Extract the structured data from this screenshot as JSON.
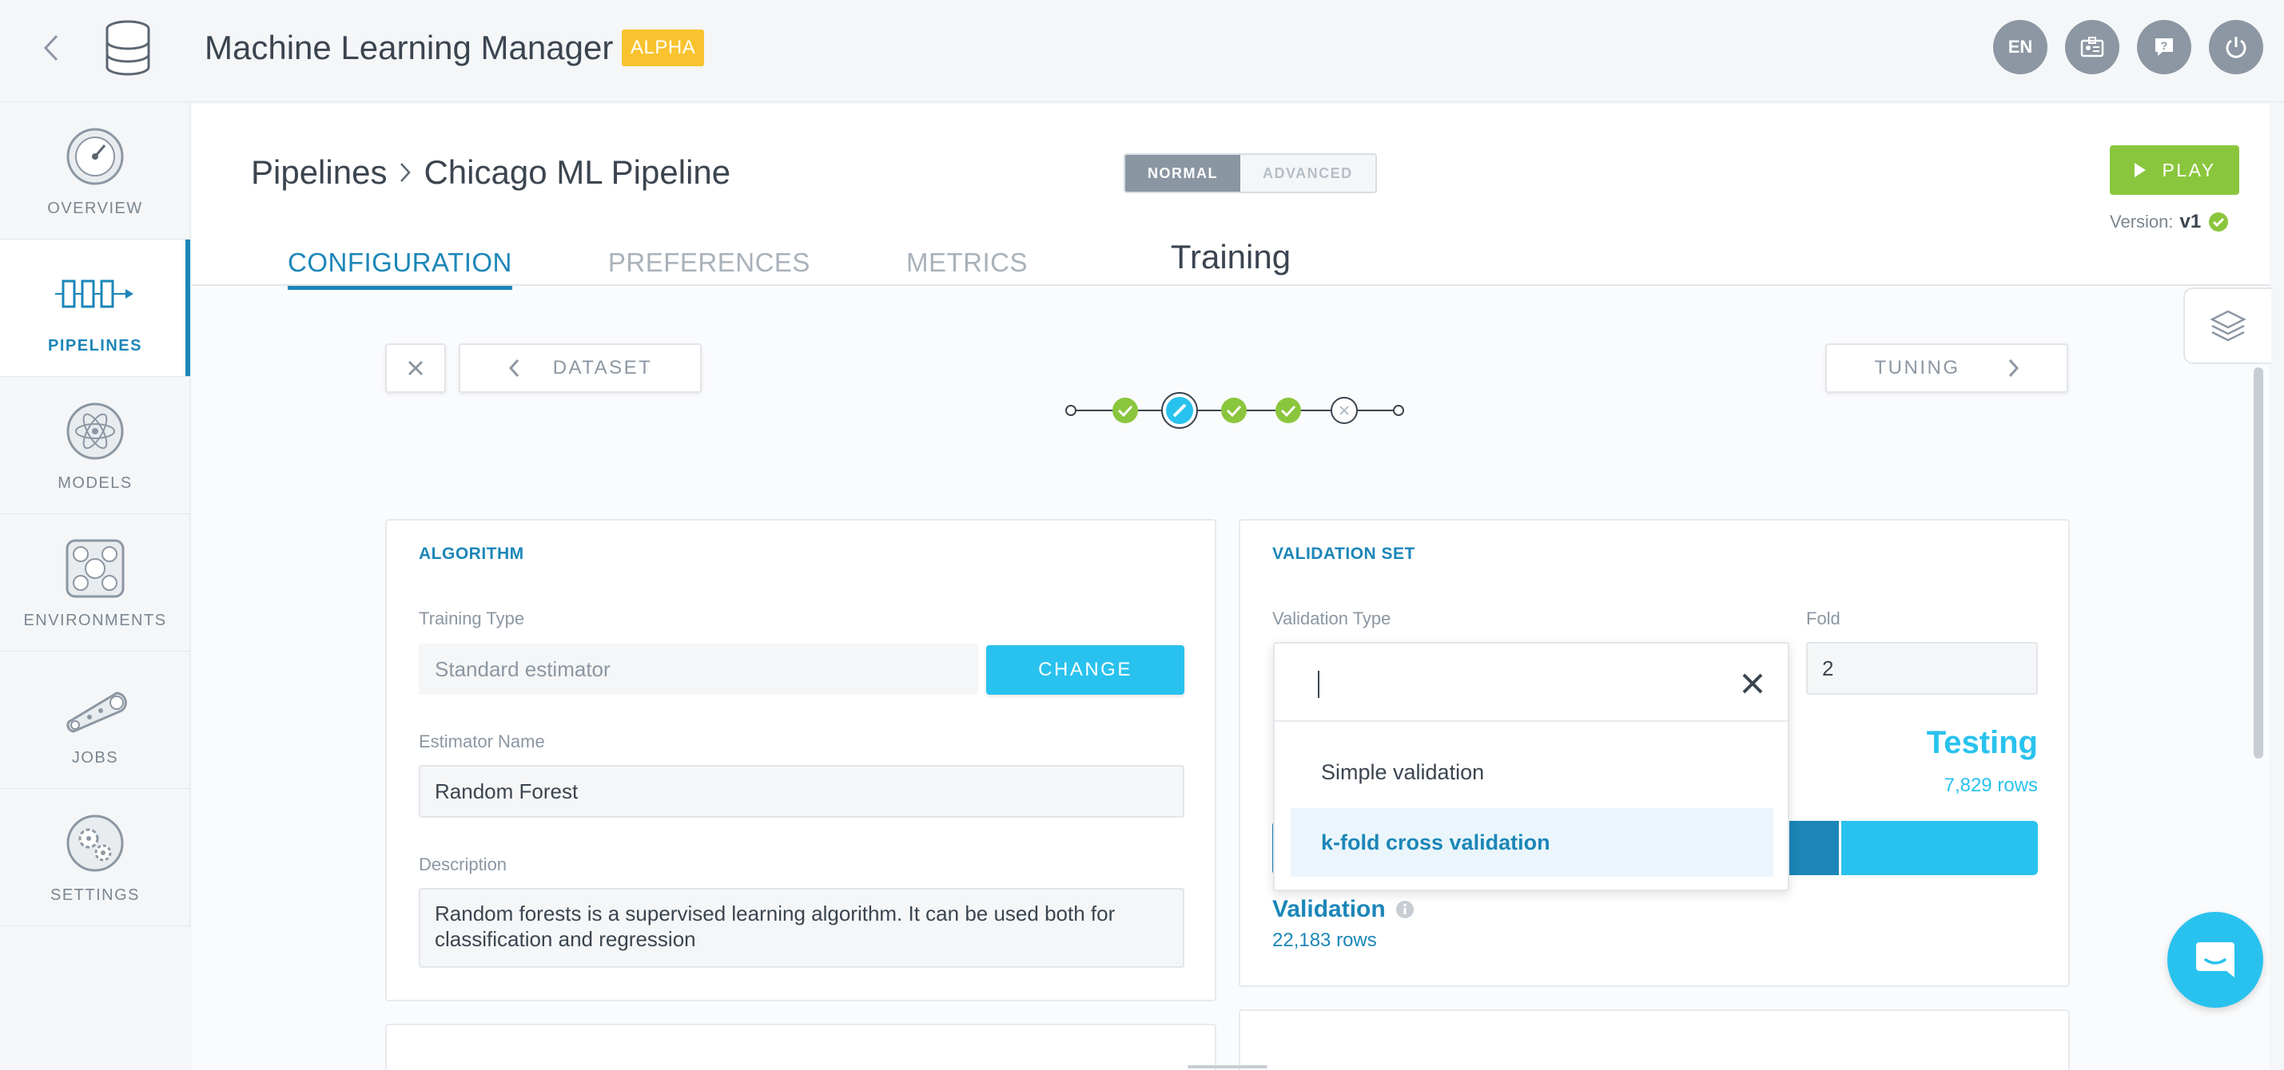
{
  "header": {
    "app_title": "Machine Learning Manager",
    "badge": "ALPHA",
    "language": "EN"
  },
  "sidebar": {
    "items": [
      {
        "label": "OVERVIEW",
        "icon": "gauge-icon"
      },
      {
        "label": "PIPELINES",
        "icon": "pipeline-icon",
        "active": true
      },
      {
        "label": "MODELS",
        "icon": "atom-icon"
      },
      {
        "label": "ENVIRONMENTS",
        "icon": "environment-icon"
      },
      {
        "label": "JOBS",
        "icon": "conveyor-icon"
      },
      {
        "label": "SETTINGS",
        "icon": "gears-icon"
      }
    ]
  },
  "breadcrumb": {
    "root": "Pipelines",
    "current": "Chicago ML Pipeline"
  },
  "mode_toggle": {
    "normal": "NORMAL",
    "advanced": "ADVANCED",
    "selected": "NORMAL"
  },
  "play_label": "PLAY",
  "version": {
    "label": "Version:",
    "value": "v1"
  },
  "tabs": [
    "CONFIGURATION",
    "PREFERENCES",
    "METRICS"
  ],
  "active_tab": "CONFIGURATION",
  "wizard": {
    "prev_label": "DATASET",
    "next_label": "TUNING",
    "step_title": "Training",
    "steps": [
      "start",
      "done",
      "current",
      "done",
      "done",
      "error",
      "end"
    ]
  },
  "algorithm": {
    "title": "ALGORITHM",
    "training_type_label": "Training Type",
    "training_type_value": "Standard estimator",
    "change_label": "CHANGE",
    "estimator_name_label": "Estimator Name",
    "estimator_name_value": "Random Forest",
    "description_label": "Description",
    "description_value": "Random forests is a supervised learning algorithm. It can be used both for classification and regression"
  },
  "validation": {
    "title": "VALIDATION SET",
    "type_label": "Validation Type",
    "fold_label": "Fold",
    "fold_value": "2",
    "testing_label": "Testing",
    "testing_rows": "7,829 rows",
    "validation_label": "Validation",
    "validation_rows": "22,183 rows",
    "dropdown_search": "",
    "options": [
      "Simple validation",
      "k-fold cross validation"
    ],
    "selected_option": "k-fold cross validation"
  },
  "colors": {
    "accent": "#1c86b8",
    "light_accent": "#29c2ee",
    "play": "#8ac63d",
    "alpha": "#f8c32e"
  }
}
